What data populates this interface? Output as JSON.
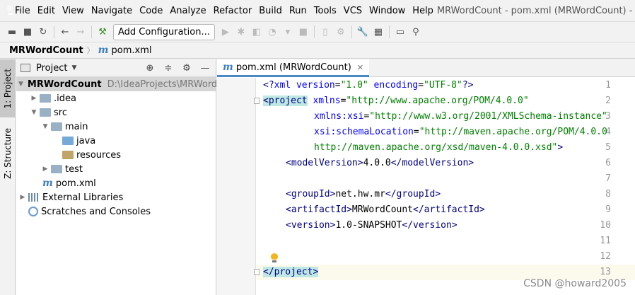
{
  "menubar": {
    "items": [
      "File",
      "Edit",
      "View",
      "Navigate",
      "Code",
      "Analyze",
      "Refactor",
      "Build",
      "Run",
      "Tools",
      "VCS",
      "Window",
      "Help"
    ],
    "window_title": "MRWordCount - pom.xml (MRWordCount) -"
  },
  "toolbar": {
    "add_configuration_label": "Add Configuration..."
  },
  "breadcrumb": {
    "project": "MRWordCount",
    "file": "pom.xml",
    "file_icon": "m"
  },
  "sidestrip": {
    "project_tab": "1: Project",
    "structure_tab": "Z: Structure"
  },
  "project_panel": {
    "title": "Project",
    "tree": [
      {
        "label": "MRWordCount",
        "path": "D:\\IdeaProjects\\MRWord",
        "expanded": true
      },
      {
        "label": ".idea"
      },
      {
        "label": "src"
      },
      {
        "label": "main"
      },
      {
        "label": "java"
      },
      {
        "label": "resources"
      },
      {
        "label": "test"
      },
      {
        "label": "pom.xml",
        "icon": "m"
      },
      {
        "label": "External Libraries"
      },
      {
        "label": "Scratches and Consoles"
      }
    ]
  },
  "editor": {
    "tab_label": "pom.xml (MRWordCount)",
    "tab_icon": "m",
    "line_numbers": [
      "1",
      "2",
      "3",
      "4",
      "5",
      "6",
      "7",
      "8",
      "9",
      "10",
      "11",
      "12",
      "13"
    ],
    "code": {
      "l1_a": "<?",
      "l1_b": "xml ",
      "l1_c": "version",
      "l1_d": "=",
      "l1_e": "\"1.0\"",
      "l1_f": " encoding",
      "l1_g": "=",
      "l1_h": "\"UTF-8\"",
      "l1_i": "?>",
      "l2_a": "<project",
      "l2_b": " xmlns",
      "l2_c": "=",
      "l2_d": "\"http://www.apache.org/POM/4.0.0\"",
      "l3_a": "xmlns:xsi",
      "l3_b": "=",
      "l3_c": "\"http://www.w3.org/2001/XMLSchema-instance\"",
      "l4_a": "xsi:schemaLocation",
      "l4_b": "=",
      "l4_c": "\"http://maven.apache.org/POM/4.0.0",
      "l5_a": "http://maven.apache.org/xsd/maven-4.0.0.xsd\"",
      "l5_b": ">",
      "l6_a": "<modelVersion>",
      "l6_b": "4.0.0",
      "l6_c": "</modelVersion>",
      "l8_a": "<groupId>",
      "l8_b": "net.hw.mr",
      "l8_c": "</groupId>",
      "l9_a": "<artifactId>",
      "l9_b": "MRWordCount",
      "l9_c": "</artifactId>",
      "l10_a": "<version>",
      "l10_b": "1.0-SNAPSHOT",
      "l10_c": "</version>",
      "l13_a": "</project>"
    }
  },
  "watermark": "CSDN @howard2005",
  "colors": {
    "tag": "#000080",
    "attribute": "#0000ff",
    "value": "#008000",
    "tab_underline": "#4a88c7",
    "maven_icon": "#3f7fc2"
  }
}
